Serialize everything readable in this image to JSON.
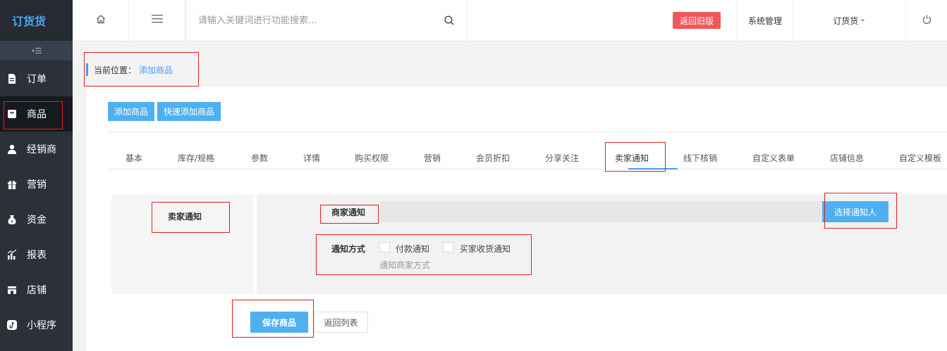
{
  "app": {
    "logo": "订货货"
  },
  "sidebar": {
    "collapse_icon": "collapse-menu-icon",
    "items": [
      {
        "label": "订单",
        "icon": "document-icon"
      },
      {
        "label": "商品",
        "icon": "bag-icon",
        "active": true
      },
      {
        "label": "经销商",
        "icon": "user-icon"
      },
      {
        "label": "营销",
        "icon": "gift-icon"
      },
      {
        "label": "资金",
        "icon": "money-bag-icon"
      },
      {
        "label": "报表",
        "icon": "bar-chart-icon"
      },
      {
        "label": "店铺",
        "icon": "shop-icon"
      },
      {
        "label": "小程序",
        "icon": "tiktok-icon"
      }
    ]
  },
  "header": {
    "search_placeholder": "请输入关键词进行功能搜索...",
    "old_version": "返回旧版",
    "system": "系统管理",
    "store_menu": "订货货",
    "store_caret": "⌄"
  },
  "breadcrumb": {
    "prefix": "当前位置：",
    "current": "添加商品"
  },
  "toolbar": {
    "add": "添加商品",
    "quick_add": "快速添加商品"
  },
  "tabs": [
    "基本",
    "库存/规格",
    "参数",
    "详情",
    "购买权限",
    "营销",
    "会员折扣",
    "分享关注",
    "卖家通知",
    "线下核销",
    "自定义表单",
    "店铺信息",
    "自定义模板"
  ],
  "active_tab": "卖家通知",
  "form": {
    "section_title": "卖家通知",
    "notify_label": "商家通知",
    "choose_button": "选择通知人",
    "method_label": "通知方式",
    "options": [
      "付款通知",
      "买家收货通知"
    ],
    "hint": "通知商家方式"
  },
  "actions": {
    "save": "保存商品",
    "back": "返回列表"
  },
  "colors": {
    "accent": "#409eff",
    "button": "#4fb0f0",
    "sidebar": "#2c3038",
    "danger": "#f0585b"
  }
}
